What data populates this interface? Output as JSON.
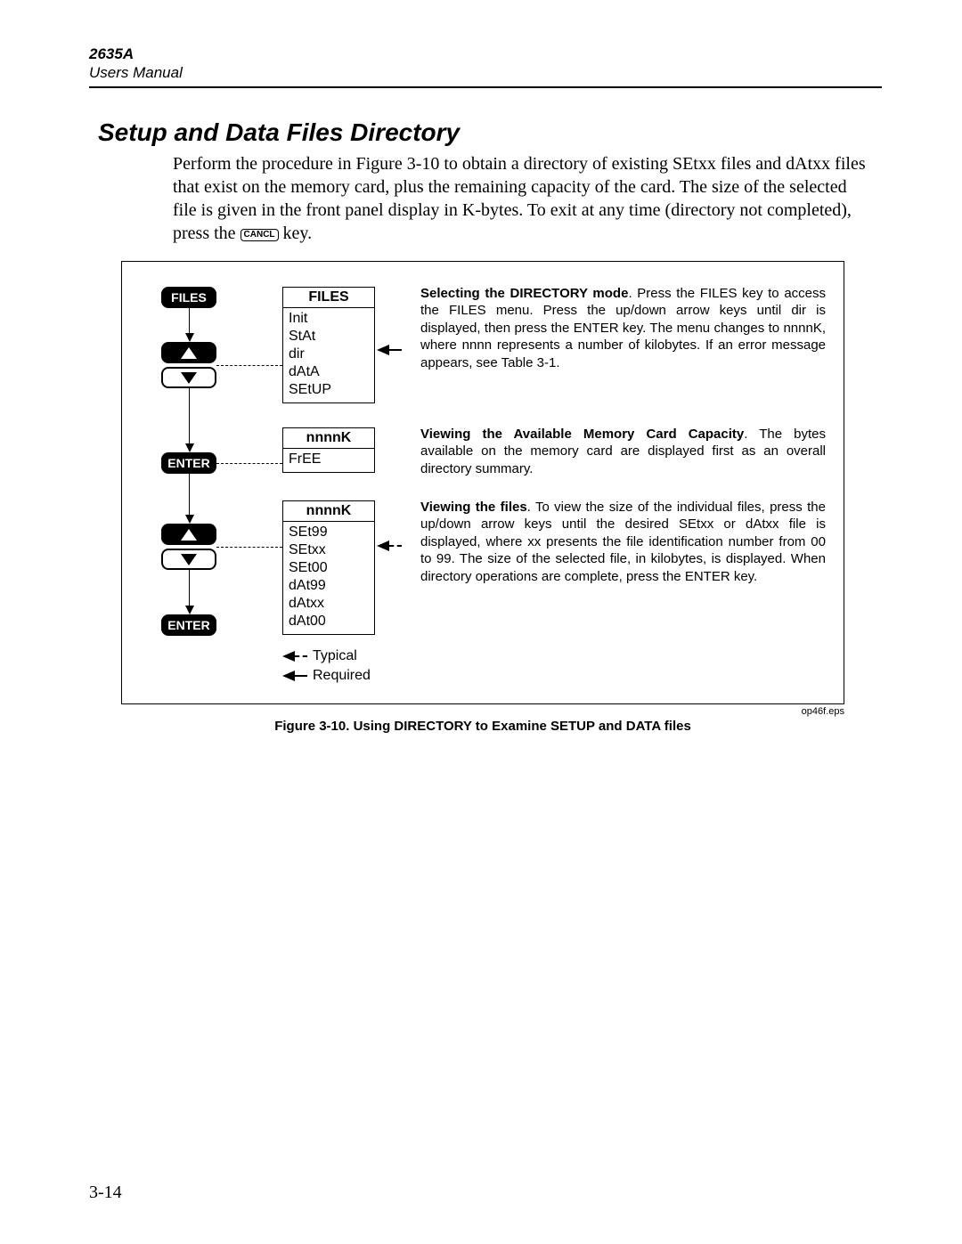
{
  "header": {
    "model": "2635A",
    "subtitle": "Users Manual"
  },
  "section_title": "Setup and Data Files Directory",
  "intro_pre": "Perform the procedure in Figure 3-10 to obtain a directory of existing SEtxx files and dAtxx files that exist on the memory card, plus the remaining capacity of the card. The size of the selected file is given in the front panel display in K-bytes. To exit at any time (directory not completed), press the ",
  "intro_cancl": "CANCL",
  "intro_post": " key.",
  "flow": {
    "files_btn": "FILES",
    "enter_btn1": "ENTER",
    "enter_btn2": "ENTER"
  },
  "disp1": {
    "header": "FILES",
    "rows": [
      "Init",
      "StAt",
      "dir",
      "dAtA",
      "SEtUP"
    ]
  },
  "disp2": {
    "header": "nnnnK",
    "rows": [
      "FrEE"
    ]
  },
  "disp3": {
    "header": "nnnnK",
    "rows": [
      "SEt99",
      "SEtxx",
      "SEt00",
      "dAt99",
      "dAtxx",
      "dAt00"
    ]
  },
  "legend": {
    "typical": "Typical",
    "required": "Required"
  },
  "explain1": {
    "lead": "Selecting the DIRECTORY mode",
    "text": ".   Press the FILES key to access the FILES menu.  Press the up/down arrow keys until dir is displayed, then press the ENTER key.  The menu changes to nnnnK, where nnnn represents a number of kilobytes.   If an error message appears, see Table 3-1."
  },
  "explain2": {
    "lead": "Viewing the Available Memory Card Capacity",
    "text": ". The bytes available on the memory card are displayed first as an overall directory summary."
  },
  "explain3": {
    "lead": "Viewing the files",
    "text": ".   To view the size of the individual files, press the up/down arrow keys until the desired SEtxx or dAtxx file is displayed, where xx presents the file identification number from 00 to 99.  The size of the selected file, in kilobytes, is displayed.   When directory operations are complete, press the ENTER key."
  },
  "eps": "op46f.eps",
  "caption": "Figure 3-10. Using DIRECTORY to Examine SETUP and DATA files",
  "page_number": "3-14"
}
